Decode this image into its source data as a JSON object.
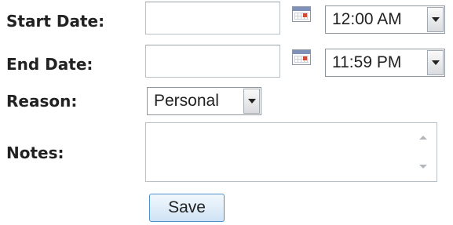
{
  "form": {
    "start_date": {
      "label": "Start Date:",
      "value": "",
      "time_value": "12:00 AM"
    },
    "end_date": {
      "label": "End Date:",
      "value": "",
      "time_value": "11:59 PM"
    },
    "reason": {
      "label": "Reason:",
      "value": "Personal"
    },
    "notes": {
      "label": "Notes:",
      "value": ""
    },
    "save_label": "Save"
  },
  "icons": {
    "calendar": "calendar-icon",
    "dropdown": "chevron-down-icon"
  },
  "colors": {
    "label_text": "#222222",
    "input_border": "#b8c0c8",
    "button_border": "#4d8fc9",
    "button_fill": "#cfe3f5"
  }
}
